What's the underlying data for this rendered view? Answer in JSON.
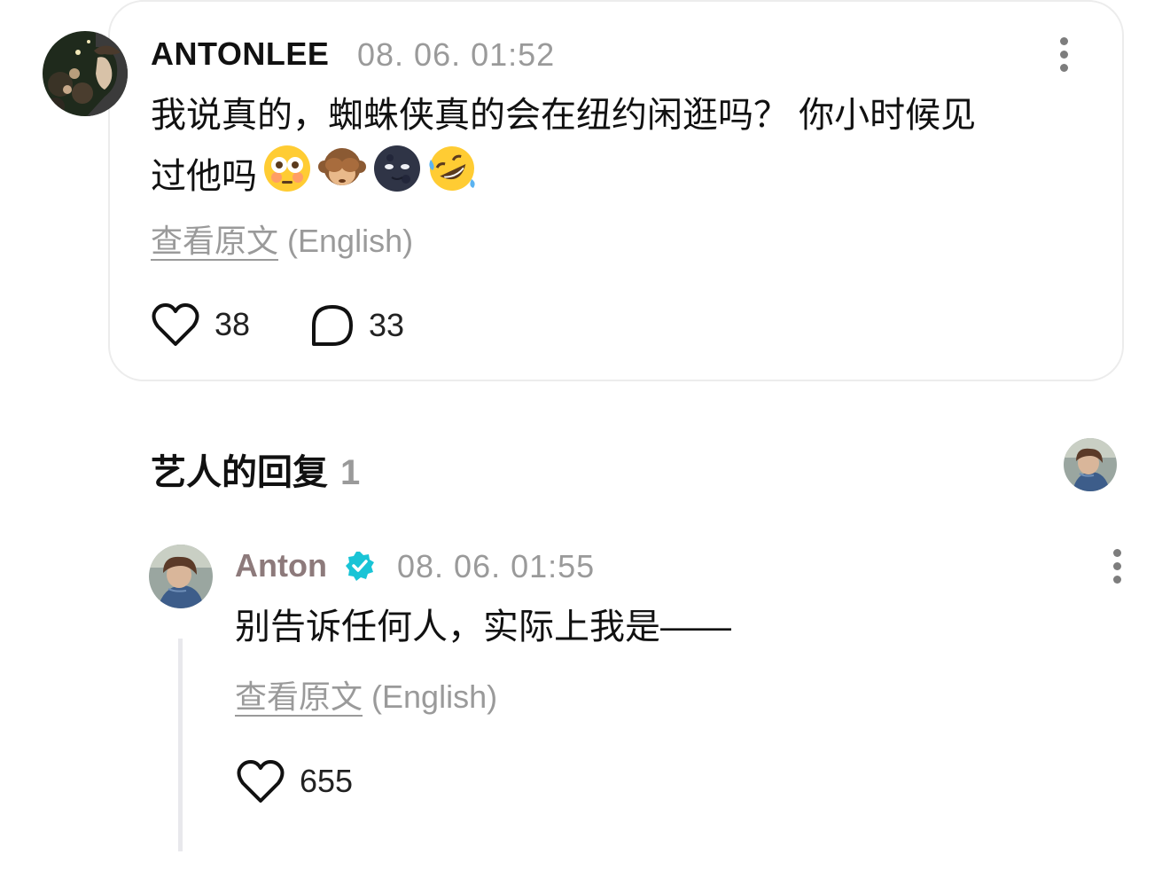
{
  "comment": {
    "username": "ANTONLEE",
    "timestamp": "08. 06. 01:52",
    "text_line1": "我说真的，蜘蛛侠真的会在纽约闲逛吗？ 你小时候见",
    "text_line2": "过他吗",
    "emojis": [
      "flushed-face",
      "see-no-evil-monkey",
      "new-moon-face",
      "rolling-on-floor-laughing"
    ],
    "translate_link": "查看原文",
    "translate_lang": "(English)",
    "likes": "38",
    "replies": "33"
  },
  "artist_replies": {
    "title": "艺人的回复",
    "count": "1"
  },
  "reply": {
    "username": "Anton",
    "verified": true,
    "timestamp": "08. 06. 01:55",
    "text": "别告诉任何人，实际上我是——",
    "translate_link": "查看原文",
    "translate_lang": "(English)",
    "likes": "655"
  },
  "colors": {
    "artist_name": "#8d7a7b",
    "verified_badge": "#19c4d6",
    "muted_text": "#9a9a9a",
    "card_border": "#ececec"
  }
}
